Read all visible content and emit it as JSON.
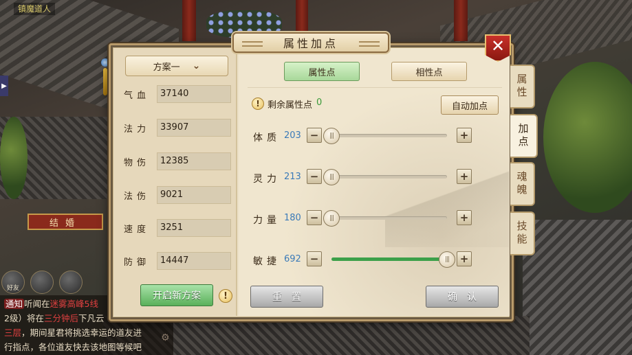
{
  "scene": {
    "npc_label": "镇魔道人",
    "marry_sign": "结婚",
    "hud": [
      "好友",
      "",
      ""
    ],
    "chat": {
      "line1_tag": "通知",
      "line1_a": "听闻在",
      "line1_b": "迷雾高峰5线",
      "line2_a": "2级）将在",
      "line2_b": "三分钟后",
      "line2_c": "下凡云",
      "line3_a": "三层",
      "line3_b": "，期间星君将挑选幸运的道友进",
      "line4": "行指点，各位道友快去该地图等候吧"
    }
  },
  "dialog": {
    "title": "属性加点",
    "close_symbol": "✕",
    "side_tabs": [
      "属性",
      "加点",
      "魂魄",
      "技能"
    ],
    "plan": {
      "selected": "方案一",
      "chevron": "⌄"
    },
    "stats": [
      {
        "label": "气血",
        "value": "37140"
      },
      {
        "label": "法力",
        "value": "33907"
      },
      {
        "label": "物伤",
        "value": "12385"
      },
      {
        "label": "法伤",
        "value": "9021"
      },
      {
        "label": "速度",
        "value": "3251"
      },
      {
        "label": "防御",
        "value": "14447"
      }
    ],
    "new_plan_button": "开启新方案",
    "warn_symbol": "!",
    "tabs": {
      "attr": "属性点",
      "affinity": "相性点"
    },
    "remaining_label": "剩余属性点",
    "remaining_value": "0",
    "auto_button": "自动加点",
    "attributes": [
      {
        "name": "体质",
        "value": "203",
        "level": 0
      },
      {
        "name": "灵力",
        "value": "213",
        "level": 0
      },
      {
        "name": "力量",
        "value": "180",
        "level": 0
      },
      {
        "name": "敏捷",
        "value": "692",
        "level": 1.0
      }
    ],
    "minus_symbol": "−",
    "plus_symbol": "+",
    "reset_button": "重置",
    "confirm_button": "确认",
    "colors": {
      "accent_green": "#3ca04a",
      "value_blue": "#3a7ab8",
      "close_red": "#c8302a"
    }
  }
}
